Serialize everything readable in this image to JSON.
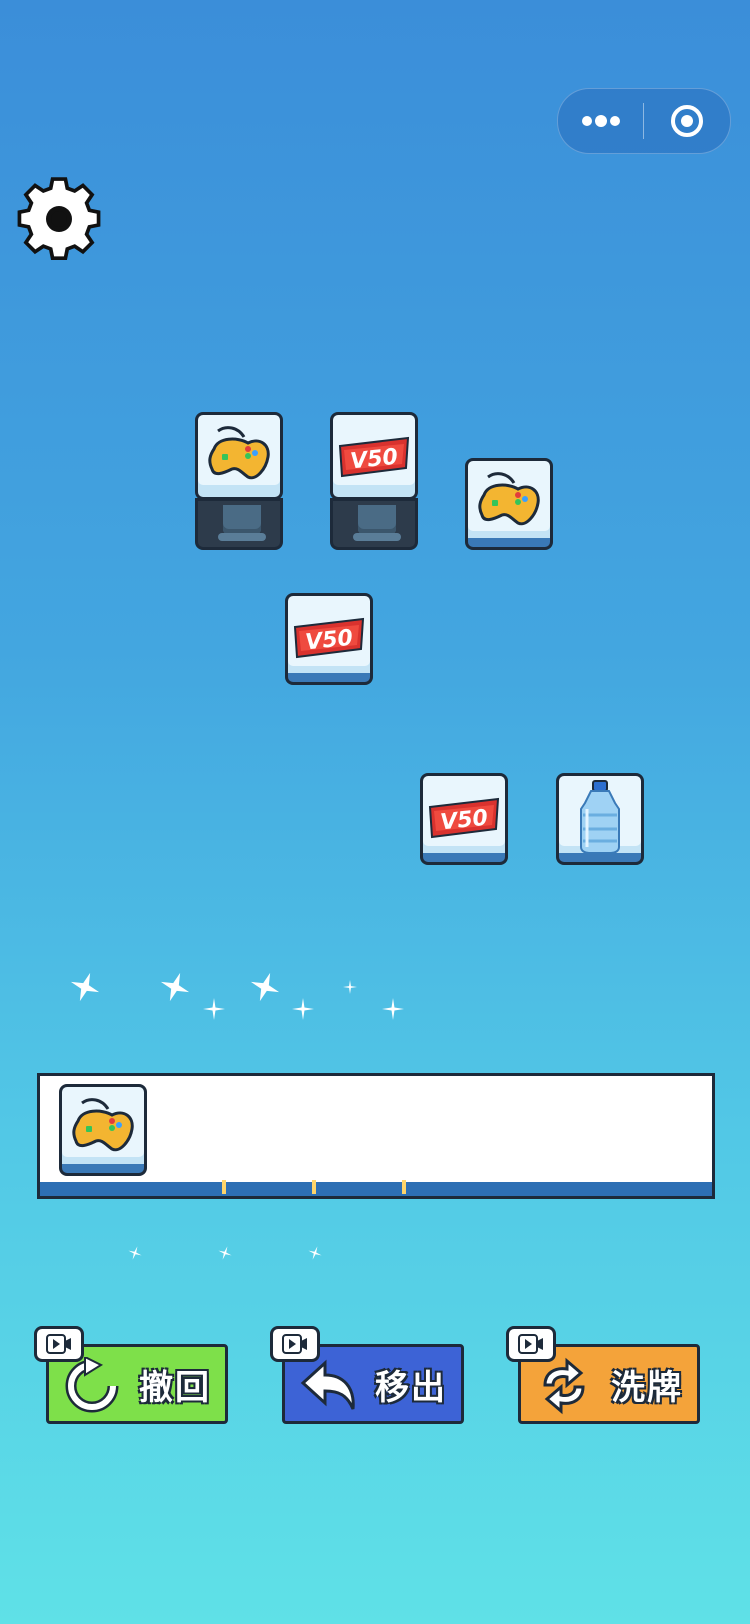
{
  "capsule": {
    "more_icon": "more-dots-icon",
    "close_icon": "target-close-icon"
  },
  "settings": {
    "icon": "gear-icon"
  },
  "board": {
    "tiles": [
      {
        "item": "gamepad",
        "state": "covered"
      },
      {
        "item": "v50-coupon",
        "text": "V50",
        "state": "covered"
      },
      {
        "item": "gamepad",
        "state": "free"
      },
      {
        "item": "v50-coupon",
        "text": "V50",
        "state": "free"
      },
      {
        "item": "v50-coupon",
        "text": "V50",
        "state": "free"
      },
      {
        "item": "water-bottle",
        "state": "free"
      }
    ]
  },
  "tray": {
    "slots": [
      {
        "item": "gamepad"
      }
    ]
  },
  "actions": {
    "undo_label": "撤回",
    "remove_label": "移出",
    "shuffle_label": "洗牌",
    "undo_color": "#7ee04a",
    "remove_color": "#3d63d6",
    "shuffle_color": "#f4a33a"
  }
}
